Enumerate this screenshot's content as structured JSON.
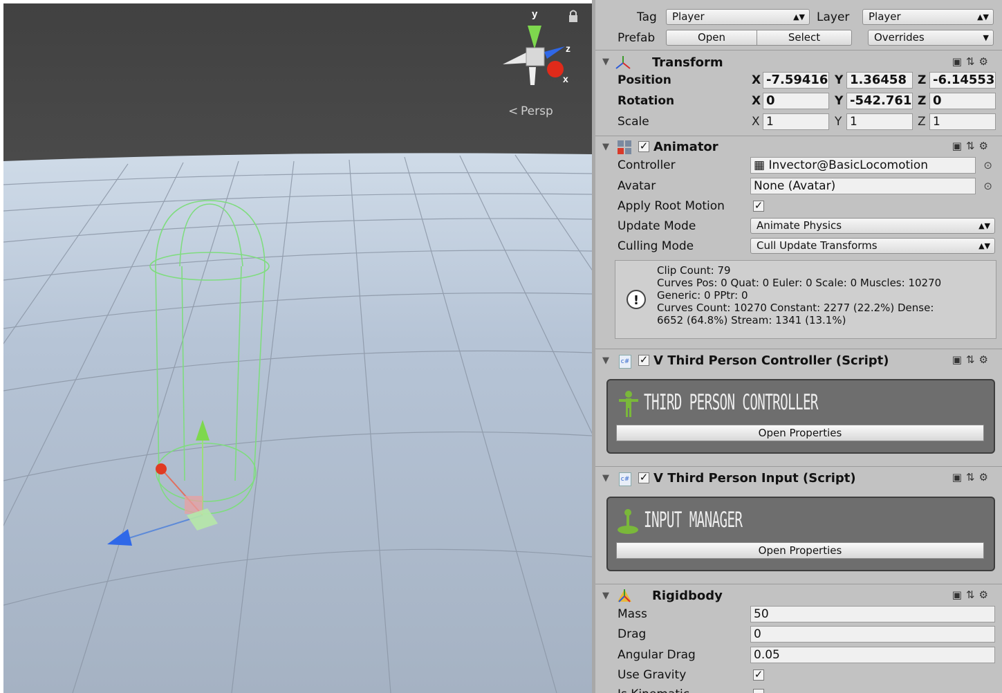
{
  "scene": {
    "axes": {
      "y": "y",
      "z": "z",
      "x": "x"
    },
    "persp_label": "Persp"
  },
  "inspector": {
    "tag_label": "Tag",
    "tag_value": "Player",
    "layer_label": "Layer",
    "layer_value": "Player",
    "prefab_label": "Prefab",
    "prefab_open": "Open",
    "prefab_select": "Select",
    "prefab_overrides": "Overrides",
    "transform": {
      "title": "Transform",
      "position_label": "Position",
      "rotation_label": "Rotation",
      "scale_label": "Scale",
      "axis_x": "X",
      "axis_y": "Y",
      "axis_z": "Z",
      "pos_x": "-7.59416",
      "pos_y": "1.36458",
      "pos_z": "-6.14553",
      "rot_x": "0",
      "rot_y": "-542.761",
      "rot_z": "0",
      "scale_x": "1",
      "scale_y": "1",
      "scale_z": "1"
    },
    "animator": {
      "title": "Animator",
      "controller_label": "Controller",
      "controller_value": "Invector@BasicLocomotion",
      "avatar_label": "Avatar",
      "avatar_value": "None (Avatar)",
      "apply_root_label": "Apply Root Motion",
      "update_mode_label": "Update Mode",
      "update_mode_value": "Animate Physics",
      "culling_mode_label": "Culling Mode",
      "culling_mode_value": "Cull Update Transforms",
      "info": [
        "Clip Count: 79",
        "Curves Pos: 0 Quat: 0 Euler: 0 Scale: 0 Muscles: 10270",
        "Generic: 0 PPtr: 0",
        "Curves Count: 10270 Constant: 2277 (22.2%) Dense:",
        "6652 (64.8%) Stream: 1341 (13.1%)"
      ]
    },
    "tpc": {
      "title": "V Third Person Controller (Script)",
      "banner": "THIRD PERSON CONTROLLER",
      "button": "Open Properties"
    },
    "tpi": {
      "title": "V Third Person Input (Script)",
      "banner": "INPUT MANAGER",
      "button": "Open Properties"
    },
    "rigidbody": {
      "title": "Rigidbody",
      "mass_label": "Mass",
      "mass_value": "50",
      "drag_label": "Drag",
      "drag_value": "0",
      "angular_label": "Angular Drag",
      "angular_value": "0.05",
      "gravity_label": "Use Gravity",
      "kinematic_label": "Is Kinematic"
    }
  }
}
